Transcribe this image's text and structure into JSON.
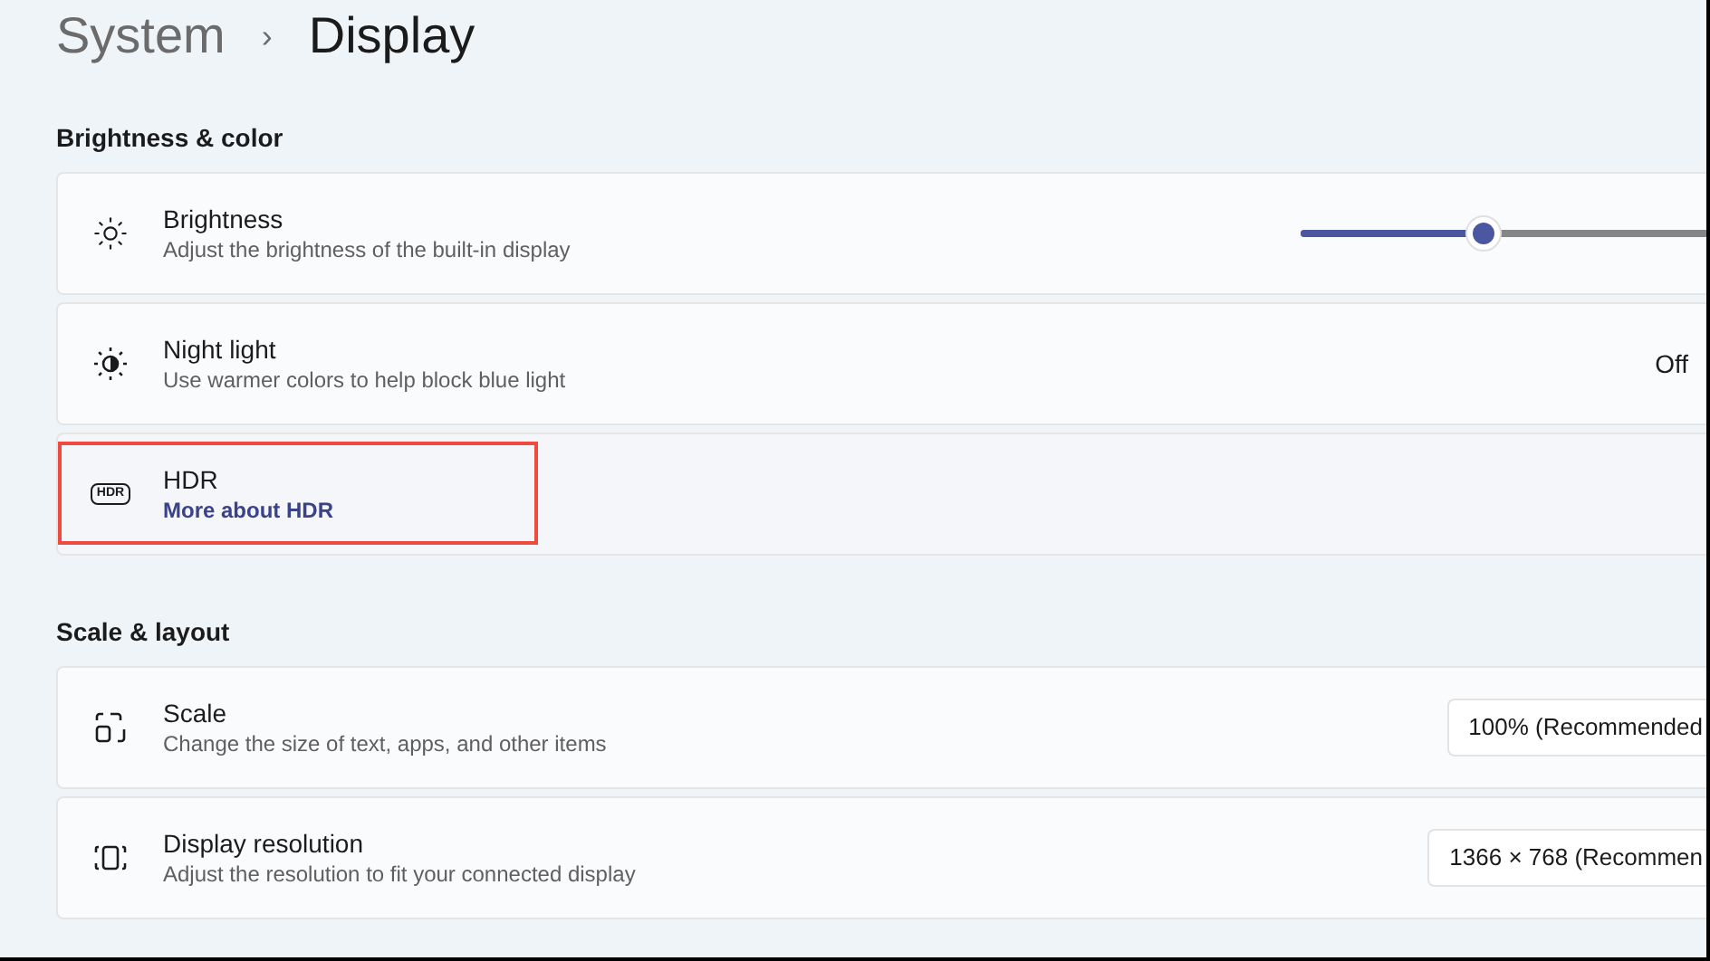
{
  "breadcrumb": {
    "parent": "System",
    "separator": "›",
    "current": "Display"
  },
  "sections": [
    {
      "title": "Brightness & color",
      "rows": [
        {
          "kind": "slider",
          "title": "Brightness",
          "subtitle": "Adjust the brightness of the built-in display",
          "level": 0.45,
          "highlighted": false
        },
        {
          "kind": "value",
          "title": "Night light",
          "subtitle": "Use warmer colors to help block blue light",
          "value": "Off",
          "highlighted": false
        },
        {
          "kind": "link",
          "icon_label": "HDR",
          "title": "HDR",
          "link": "More about HDR",
          "highlighted": true
        }
      ]
    },
    {
      "title": "Scale & layout",
      "rows": [
        {
          "kind": "dropdown",
          "title": "Scale",
          "subtitle": "Change the size of text, apps, and other items",
          "value": "100% (Recommended",
          "highlighted": false
        },
        {
          "kind": "dropdown",
          "title": "Display resolution",
          "subtitle": "Adjust the resolution to fit your connected display",
          "value": "1366 × 768 (Recommen",
          "highlighted": false
        }
      ]
    }
  ]
}
